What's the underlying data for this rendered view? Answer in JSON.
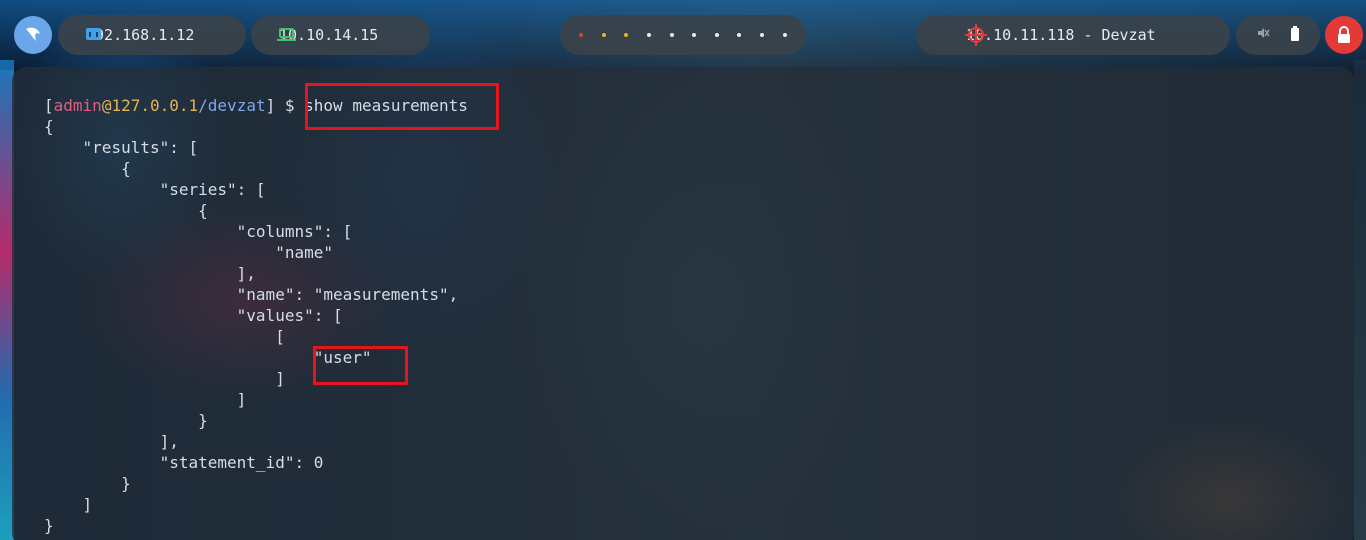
{
  "topbar": {
    "ip_local": "192.168.1.12",
    "ip_vpn": "10.10.14.15",
    "target": "10.10.11.118 - Devzat",
    "workspaces": [
      {
        "state": "active",
        "color": "#e53935"
      },
      {
        "state": "used",
        "color": "#f2b01e"
      },
      {
        "state": "used",
        "color": "#f2b01e"
      },
      {
        "state": "empty",
        "color": "#e8eaed"
      },
      {
        "state": "empty",
        "color": "#e8eaed"
      },
      {
        "state": "empty",
        "color": "#e8eaed"
      },
      {
        "state": "empty",
        "color": "#e8eaed"
      },
      {
        "state": "empty",
        "color": "#e8eaed"
      },
      {
        "state": "empty",
        "color": "#e8eaed"
      },
      {
        "state": "empty",
        "color": "#e8eaed"
      }
    ],
    "icons": [
      "parrot-logo-icon",
      "network-icon",
      "laptop-icon",
      "target-icon",
      "mute-icon",
      "battery-icon",
      "lock-icon"
    ]
  },
  "terminal": {
    "prompt": {
      "open": "[",
      "user": "admin",
      "at": "@",
      "host": "127.0.0.1",
      "path": "/devzat",
      "close": "]",
      "symbol": "$"
    },
    "command": "show measurements",
    "output": [
      "{",
      "    \"results\": [",
      "        {",
      "            \"series\": [",
      "                {",
      "                    \"columns\": [",
      "                        \"name\"",
      "                    ],",
      "                    \"name\": \"measurements\",",
      "                    \"values\": [",
      "                        [",
      "                            \"user\"",
      "                        ]",
      "                    ]",
      "                }",
      "            ],",
      "            \"statement_id\": 0",
      "        }",
      "    ]",
      "}"
    ]
  },
  "colors": {
    "prompt_user": "#e0607e",
    "prompt_host": "#e6b450",
    "prompt_path": "#7fa8e8",
    "highlight": "#e8141b"
  }
}
